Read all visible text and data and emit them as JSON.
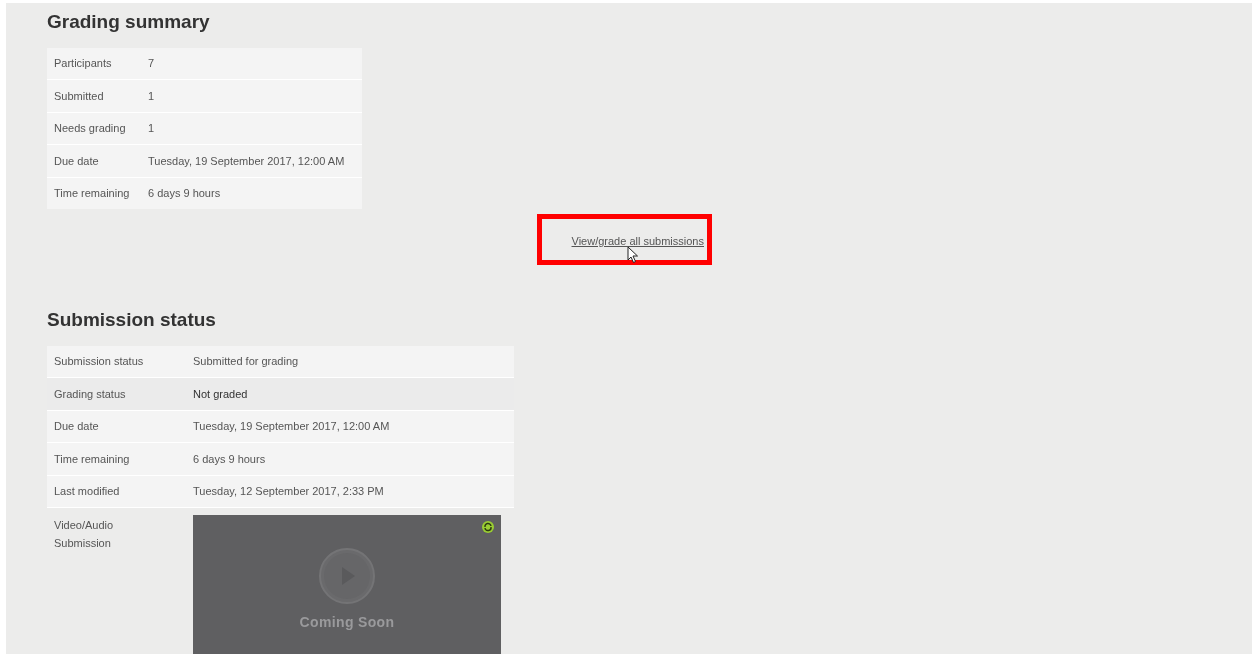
{
  "grading_summary": {
    "heading": "Grading summary",
    "rows": [
      {
        "label": "Participants",
        "value": "7"
      },
      {
        "label": "Submitted",
        "value": "1"
      },
      {
        "label": "Needs grading",
        "value": "1"
      },
      {
        "label": "Due date",
        "value": "Tuesday, 19 September 2017, 12:00 AM"
      },
      {
        "label": "Time remaining",
        "value": "6 days 9 hours"
      }
    ],
    "link": {
      "label": "View/grade all submissions",
      "highlighted": true
    }
  },
  "submission_status": {
    "heading": "Submission status",
    "rows": [
      {
        "label": "Submission status",
        "value": "Submitted for grading",
        "hovered": false
      },
      {
        "label": "Grading status",
        "value": "Not graded",
        "hovered": true
      },
      {
        "label": "Due date",
        "value": "Tuesday, 19 September 2017, 12:00 AM",
        "hovered": false
      },
      {
        "label": "Time remaining",
        "value": "6 days 9 hours",
        "hovered": false
      },
      {
        "label": "Last modified",
        "value": "Tuesday, 12 September 2017, 2:33 PM",
        "hovered": false
      }
    ],
    "media": {
      "label": "Video/Audio Submission",
      "player_text": "Coming Soon"
    }
  }
}
